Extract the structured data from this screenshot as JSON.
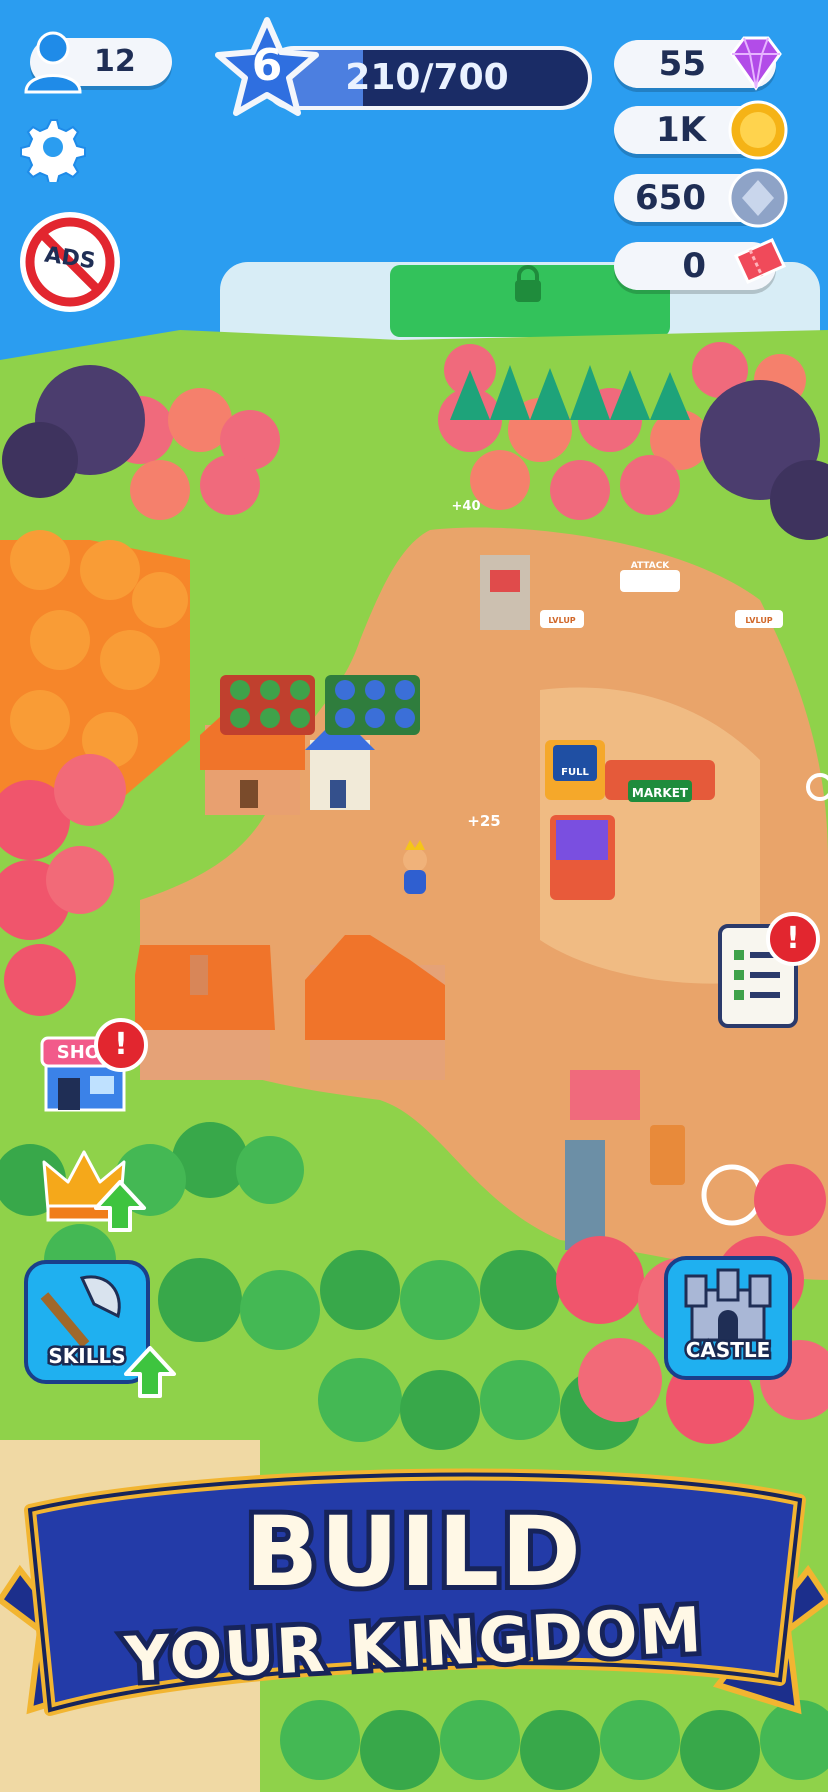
{
  "hud": {
    "players_count": "12",
    "level": "6",
    "xp_text": "210/700",
    "xp_progress": 0.3,
    "gems": "55",
    "coins": "1K",
    "silver": "650",
    "tickets": "0"
  },
  "ads_button": {
    "label": "ADS"
  },
  "world_labels": {
    "market_sign": "MARKET",
    "full_tag": "FULL",
    "attack_tag": "ATTACK",
    "lvlup_tag_1": "LVLUP",
    "lvlup_tag_2": "LVLUP",
    "popup_plus_40": "+40",
    "popup_plus_25": "+25"
  },
  "side_buttons": {
    "shop_label": "SHOP",
    "skills_label": "SKILLS",
    "castle_label": "CASTLE",
    "alert_mark": "!"
  },
  "banner": {
    "line1": "BUILD",
    "line2": "YOUR KINGDOM"
  },
  "colors": {
    "water": "#2b9df0",
    "grass": "#8fd24a",
    "dirt": "#e9a46a",
    "banner_blue": "#233ba8",
    "banner_gold": "#f2b531",
    "hud_text": "#1f2e55",
    "xp_fill": "#4c7fe0",
    "gem": "#b24ce8",
    "coin": "#f5b316",
    "alert": "#e2262f"
  }
}
